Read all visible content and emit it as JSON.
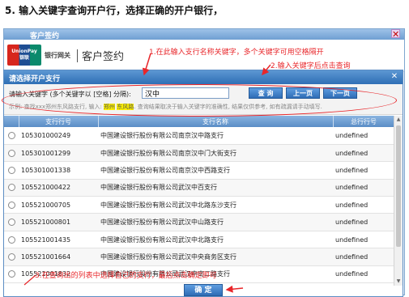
{
  "heading": "5. 输入关键字查询开户行，选择正确的开户银行，",
  "outer_window": {
    "title": "客户签约",
    "close_glyph": "✕",
    "brand": {
      "logo_text_top": "UnionPay",
      "logo_text_bottom": "银联",
      "gateway_text": "银行网关",
      "page_title": "客户签约"
    }
  },
  "dialog": {
    "title": "请选择开户支行",
    "close_glyph": "✕",
    "search": {
      "label": "请输入关键字 (多个关键字以 [空格] 分隔):",
      "value": "汉中",
      "query_button": "查 询",
      "prev_button": "上一页",
      "next_button": "下一页"
    },
    "hint": {
      "prefix": "示例: 查找xxx郑州东风路支行, 输入: ",
      "keyword1": "郑州",
      "keyword2": "东风路",
      "suffix": ". 查询结果取决于输入关键字的准确性, 结果仅供参考, 如有疏漏请手动填写."
    },
    "table": {
      "columns": [
        "",
        "支行行号",
        "支行名称",
        "总行行号"
      ],
      "rows": [
        [
          "105301000249",
          "中国建设银行股份有限公司南京汉中路支行",
          "undefined"
        ],
        [
          "105301001299",
          "中国建设银行股份有限公司南京汉中门大街支行",
          "undefined"
        ],
        [
          "105301001338",
          "中国建设银行股份有限公司南京汉中西路支行",
          "undefined"
        ],
        [
          "105521000422",
          "中国建设银行股份有限公司武汉中百支行",
          "undefined"
        ],
        [
          "105521000705",
          "中国建设银行股份有限公司武汉中北路东沙支行",
          "undefined"
        ],
        [
          "105521000801",
          "中国建设银行股份有限公司武汉中山路支行",
          "undefined"
        ],
        [
          "105521001435",
          "中国建设银行股份有限公司武汉中北路支行",
          "undefined"
        ],
        [
          "105521001664",
          "中国建设银行股份有限公司武汉中央商务区支行",
          "undefined"
        ],
        [
          "105521001832",
          "中国建设银行股份有限公司武汉中南二路支行",
          "undefined"
        ]
      ]
    },
    "confirm_button": "确 定"
  },
  "annotations": {
    "step1": "1.在此输入支行名称关键字，多个关键字可用空格隔开",
    "step2": "2.输入关键字后点击查询",
    "step3": "3.在查询出的列表中选择自己的支行，最后点击确定即可"
  },
  "colors": {
    "annotation_red": "#e8262a",
    "dialog_blue": "#2f6fb5",
    "highlight_yellow": "#fff200"
  }
}
